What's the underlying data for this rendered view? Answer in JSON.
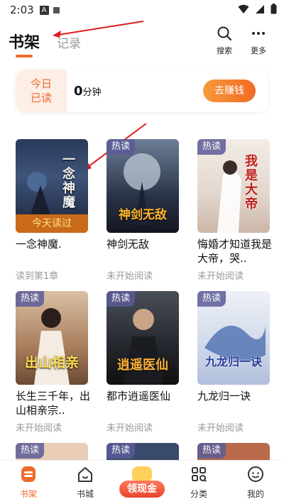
{
  "status_bar": {
    "time": "2:03",
    "note_glyph": "A"
  },
  "header": {
    "tab_active": "书架",
    "tab_inactive": "记录",
    "search_label": "搜索",
    "more_label": "更多"
  },
  "read_card": {
    "today_line1": "今日",
    "today_line2": "已读",
    "minutes_value": "0",
    "minutes_unit": "分钟",
    "earn_button": "去赚钱"
  },
  "books": [
    {
      "title": "一念神魔.",
      "status": "读到第1章",
      "cover_title": "一念神魔",
      "banner": "今天读过",
      "badge": ""
    },
    {
      "title": "神剑无敌",
      "status": "未开始阅读",
      "cover_title": "神剑无敌",
      "banner": "",
      "badge": "热读"
    },
    {
      "title": "悔婚才知道我是大帝，哭..",
      "status": "未开始阅读",
      "cover_title": "我是大帝",
      "banner": "",
      "badge": "热读"
    },
    {
      "title": "长生三千年，出山相亲宗..",
      "status": "未开始阅读",
      "cover_title": "出山相亲",
      "banner": "",
      "badge": "热读"
    },
    {
      "title": "都市逍遥医仙",
      "status": "未开始阅读",
      "cover_title": "逍遥医仙",
      "banner": "",
      "badge": "热读"
    },
    {
      "title": "九龙归一诀",
      "status": "未开始阅读",
      "cover_title": "九龙归一诀",
      "banner": "",
      "badge": "热读"
    }
  ],
  "partial_badges": [
    "热读",
    "热读",
    "热读"
  ],
  "bottom_nav": {
    "bookshelf": "书架",
    "store": "书城",
    "cash": "领现金",
    "category": "分类",
    "mine": "我的"
  },
  "colors": {
    "accent": "#f06a2a",
    "muted_text": "#999999"
  }
}
